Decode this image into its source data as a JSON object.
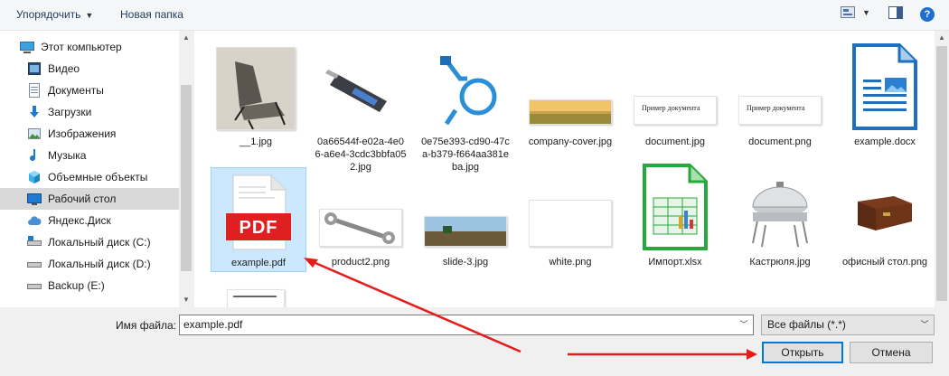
{
  "toolbar": {
    "organize_label": "Упорядочить",
    "new_folder_label": "Новая папка",
    "help_label": "?"
  },
  "sidebar": {
    "items": [
      {
        "label": "Этот компьютер",
        "icon": "computer-icon"
      },
      {
        "label": "Видео",
        "icon": "video-icon"
      },
      {
        "label": "Документы",
        "icon": "documents-icon"
      },
      {
        "label": "Загрузки",
        "icon": "downloads-icon"
      },
      {
        "label": "Изображения",
        "icon": "pictures-icon"
      },
      {
        "label": "Музыка",
        "icon": "music-icon"
      },
      {
        "label": "Объемные объекты",
        "icon": "3d-objects-icon"
      },
      {
        "label": "Рабочий стол",
        "icon": "desktop-icon",
        "selected": true
      },
      {
        "label": "Яндекс.Диск",
        "icon": "cloud-icon"
      },
      {
        "label": "Локальный диск (C:)",
        "icon": "drive-icon"
      },
      {
        "label": "Локальный диск (D:)",
        "icon": "drive-icon"
      },
      {
        "label": "Backup (E:)",
        "icon": "drive-icon"
      }
    ]
  },
  "files": [
    {
      "name": "__1.jpg",
      "icon": "chair-photo"
    },
    {
      "name": "0a66544f-e02a-4e06-a6e4-3cdc3bbfa052.jpg",
      "icon": "rotary-tool-photo"
    },
    {
      "name": "0e75e393-cd90-47ca-b379-f664aa381eba.jpg",
      "icon": "blue-hose-photo"
    },
    {
      "name": "company-cover.jpg",
      "icon": "field-banner-photo"
    },
    {
      "name": "document.jpg",
      "icon": "document-thumb",
      "thumb_text": "Пример документа"
    },
    {
      "name": "document.png",
      "icon": "document-thumb",
      "thumb_text": "Пример документа"
    },
    {
      "name": "example.docx",
      "icon": "writer-doc-icon"
    },
    {
      "name": "example.pdf",
      "icon": "pdf-icon",
      "selected": true,
      "thumb_text": "PDF"
    },
    {
      "name": "product2.png",
      "icon": "wrench-photo"
    },
    {
      "name": "slide-3.jpg",
      "icon": "tractor-field-photo"
    },
    {
      "name": "white.png",
      "icon": "white-image"
    },
    {
      "name": "Импорт.xlsx",
      "icon": "calc-sheet-icon"
    },
    {
      "name": "Кастрюля.jpg",
      "icon": "chafing-dish-photo"
    },
    {
      "name": "офисный стол.png",
      "icon": "office-desk-photo"
    },
    {
      "name": "",
      "icon": "document-thumb-partial"
    }
  ],
  "bottom": {
    "filename_label": "Имя файла:",
    "filename_value": "example.pdf",
    "filter_value": "Все файлы (*.*)",
    "open_label": "Открыть",
    "cancel_label": "Отмена"
  },
  "colors": {
    "selection_bg": "#cce8ff",
    "selection_border": "#99d1ff",
    "arrow": "#e81b1b",
    "primary_border": "#0078d7"
  }
}
